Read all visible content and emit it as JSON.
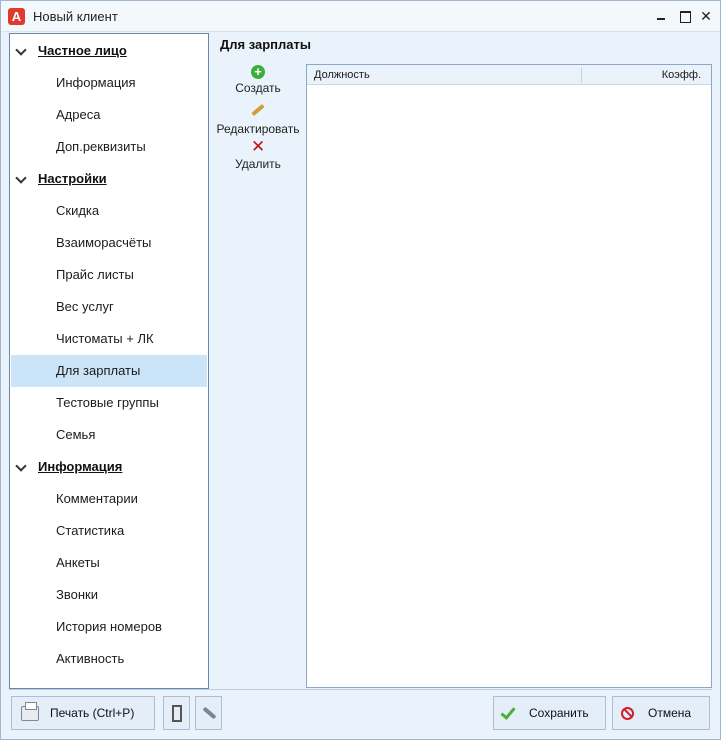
{
  "window": {
    "title": "Новый клиент"
  },
  "nav": {
    "group_private": "Частное лицо",
    "info": "Информация",
    "addresses": "Адреса",
    "extra_requisites": "Доп.реквизиты",
    "group_settings": "Настройки",
    "discount": "Скидка",
    "settlements": "Взаиморасчёты",
    "price_lists": "Прайс листы",
    "service_weight": "Вес услуг",
    "cleaning_mats": "Чистоматы + ЛК",
    "for_salary": "Для зарплаты",
    "test_groups": "Тестовые группы",
    "family": "Семья",
    "group_information": "Информация",
    "comments": "Комментарии",
    "statistics": "Статистика",
    "questionnaires": "Анкеты",
    "calls": "Звонки",
    "number_history": "История номеров",
    "activity": "Активность",
    "selected": "Для зарплаты"
  },
  "content": {
    "title": "Для зарплаты",
    "toolbar": {
      "create_label": "Создать",
      "edit_label": "Редактировать",
      "delete_label": "Удалить"
    },
    "grid": {
      "columns": [
        "Должность",
        "Коэфф."
      ],
      "rows": []
    }
  },
  "footer": {
    "print_label": "Печать (Ctrl+P)",
    "save_label": "Сохранить",
    "cancel_label": "Отмена"
  },
  "icons": {
    "create": "plus-circle-icon",
    "edit": "pencil-icon",
    "delete": "x-icon",
    "print": "printer-icon",
    "save": "checkmark-icon",
    "cancel": "no-entry-icon"
  },
  "colors": {
    "accent": "#cce4f7",
    "create": "#3cae3c",
    "delete": "#c0121e",
    "save": "#4caf3a",
    "cancel": "#d01f27"
  }
}
